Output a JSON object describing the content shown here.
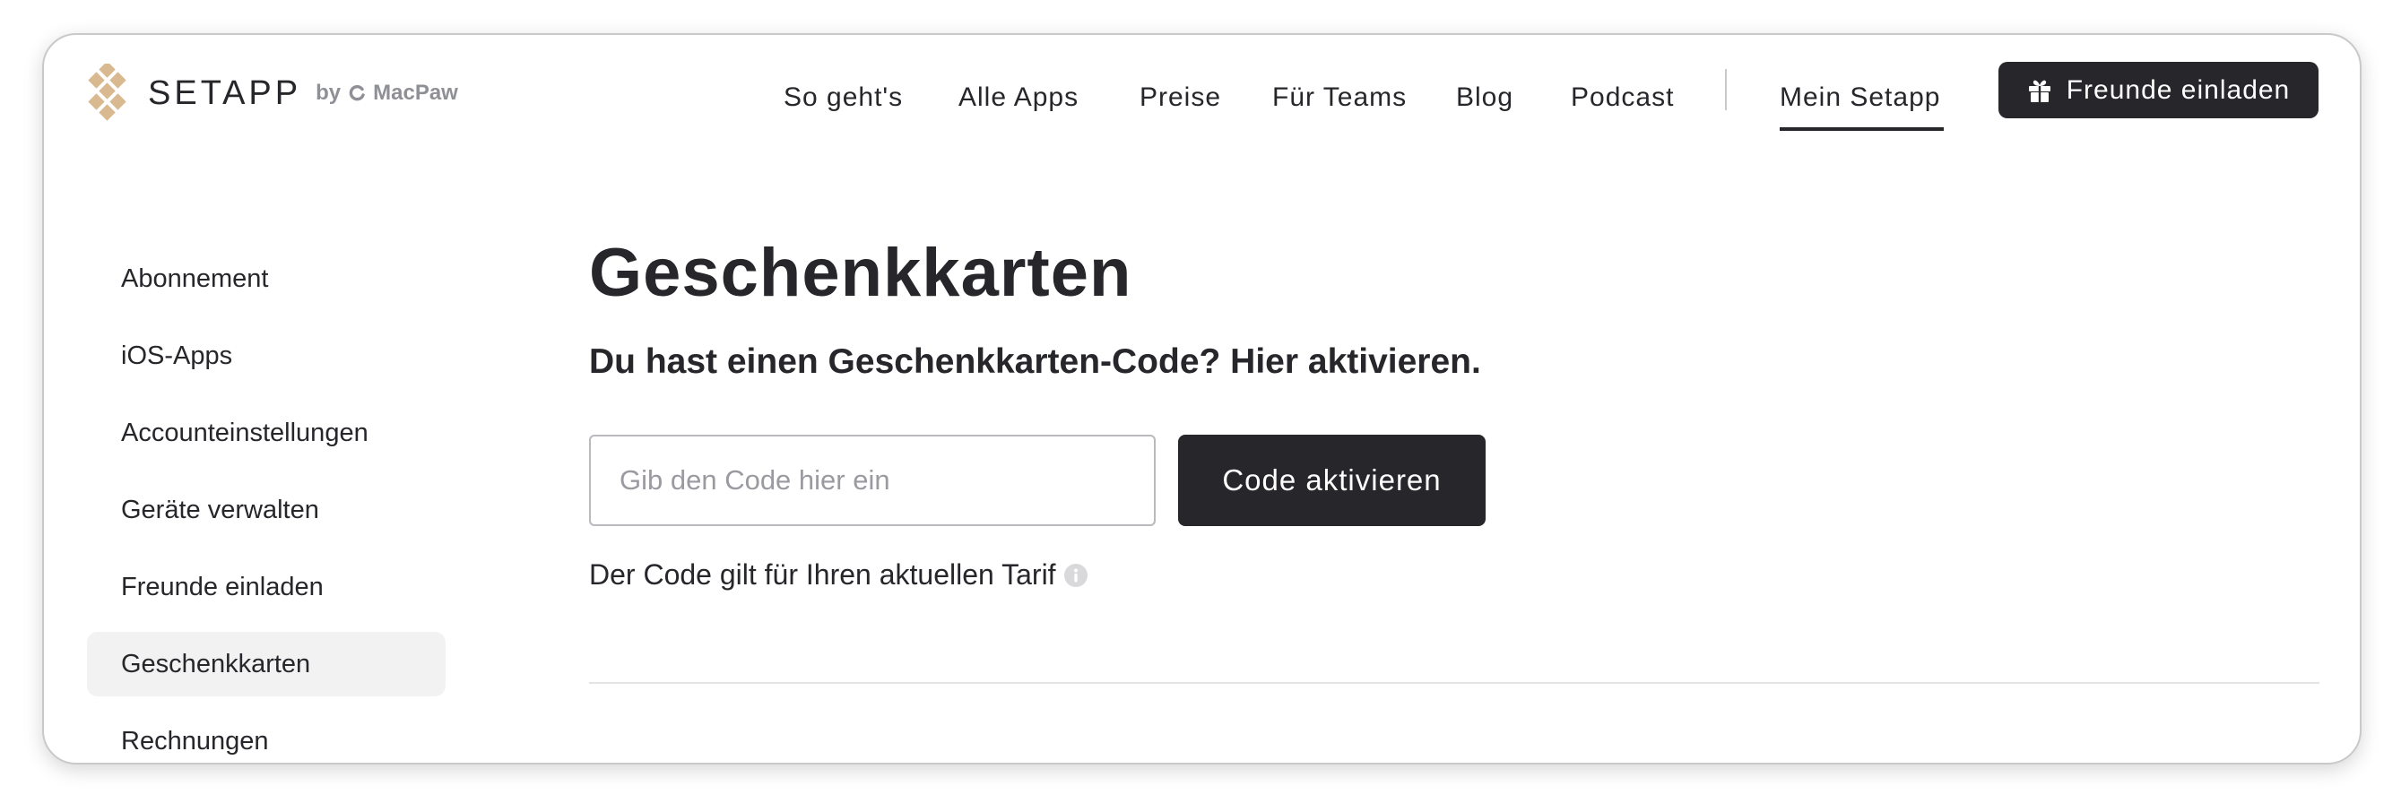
{
  "header": {
    "brand": "SETAPP",
    "by_label": "by",
    "company": "MacPaw",
    "nav": [
      {
        "label": "So geht's"
      },
      {
        "label": "Alle Apps"
      },
      {
        "label": "Preise"
      },
      {
        "label": "Für Teams"
      },
      {
        "label": "Blog"
      },
      {
        "label": "Podcast"
      }
    ],
    "account_link": "Mein Setapp",
    "invite_button": "Freunde einladen"
  },
  "sidebar": {
    "active": "Geschenkkarten",
    "items": [
      {
        "label": "Abonnement"
      },
      {
        "label": "iOS-Apps"
      },
      {
        "label": "Accounteinstellungen"
      },
      {
        "label": "Geräte verwalten"
      },
      {
        "label": "Freunde einladen"
      },
      {
        "label": "Geschenkkarten"
      },
      {
        "label": "Rechnungen"
      }
    ]
  },
  "main": {
    "title": "Geschenkkarten",
    "subtitle": "Du hast einen Geschenkkarten-Code? Hier aktivieren.",
    "code_input": {
      "value": "",
      "placeholder": "Gib den Code hier ein"
    },
    "activate_button": "Code aktivieren",
    "note": "Der Code gilt für Ihren aktuellen Tarif"
  },
  "colors": {
    "dark": "#26262b",
    "logo_accent": "#d9b98f",
    "sidebar_active_bg": "#f2f2f3"
  },
  "icons": {
    "logo": "setapp-logo-icon",
    "macpaw": "macpaw-icon",
    "gift": "gift-icon",
    "info": "info-icon"
  }
}
